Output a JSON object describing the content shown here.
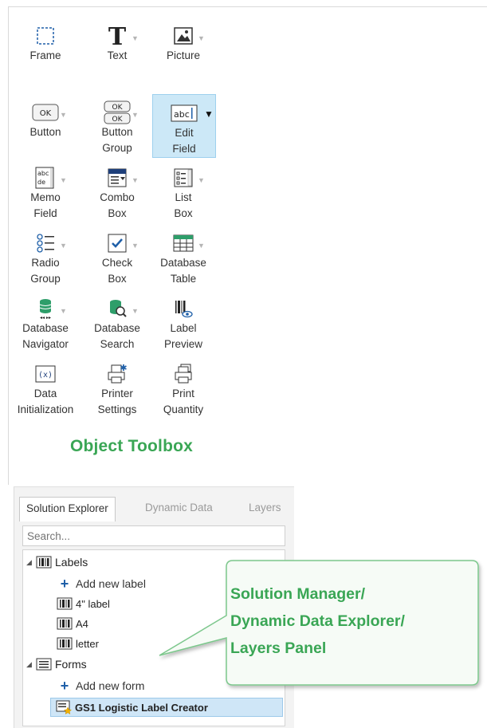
{
  "toolbox": {
    "title": "Object Toolbox",
    "tools": [
      {
        "label": "Frame",
        "icon": "frame-icon",
        "arrow": false
      },
      {
        "label": "Text",
        "icon": "text-icon",
        "arrow": true
      },
      {
        "label": "Picture",
        "icon": "picture-icon",
        "arrow": true
      },
      {
        "label": "Button",
        "icon": "button-icon",
        "arrow": true
      },
      {
        "label": "Button\nGroup",
        "icon": "button-group-icon",
        "arrow": true
      },
      {
        "label": "Edit\nField",
        "icon": "edit-field-icon",
        "arrow": true,
        "selected": true
      },
      {
        "label": "Memo\nField",
        "icon": "memo-field-icon",
        "arrow": true
      },
      {
        "label": "Combo\nBox",
        "icon": "combo-box-icon",
        "arrow": true
      },
      {
        "label": "List\nBox",
        "icon": "list-box-icon",
        "arrow": true
      },
      {
        "label": "Radio\nGroup",
        "icon": "radio-group-icon",
        "arrow": true
      },
      {
        "label": "Check\nBox",
        "icon": "check-box-icon",
        "arrow": true
      },
      {
        "label": "Database\nTable",
        "icon": "database-table-icon",
        "arrow": true
      },
      {
        "label": "Database\nNavigator",
        "icon": "database-navigator-icon",
        "arrow": true
      },
      {
        "label": "Database\nSearch",
        "icon": "database-search-icon",
        "arrow": true
      },
      {
        "label": "Label\nPreview",
        "icon": "label-preview-icon",
        "arrow": false
      },
      {
        "label": "Data\nInitialization",
        "icon": "data-initialization-icon",
        "arrow": false
      },
      {
        "label": "Printer\nSettings",
        "icon": "printer-settings-icon",
        "arrow": false
      },
      {
        "label": "Print\nQuantity",
        "icon": "print-quantity-icon",
        "arrow": false
      }
    ]
  },
  "panel": {
    "tabs": [
      "Solution Explorer",
      "Dynamic Data",
      "Layers"
    ],
    "active_tab": "Solution Explorer",
    "search_placeholder": "Search...",
    "tree": {
      "labels_group": "Labels",
      "add_label": "Add new label",
      "labels": [
        "4\" label",
        "A4",
        "letter"
      ],
      "forms_group": "Forms",
      "add_form": "Add new form",
      "forms": [
        "GS1 Logistic Label Creator"
      ]
    }
  },
  "callout": {
    "lines": [
      "Solution Manager/",
      "Dynamic Data Explorer/",
      "Layers Panel"
    ]
  },
  "colors": {
    "accent_green": "#3aa655",
    "selection_blue": "#cce8f7",
    "icon_blue": "#1e5fa8",
    "db_green": "#2e9e6a"
  }
}
